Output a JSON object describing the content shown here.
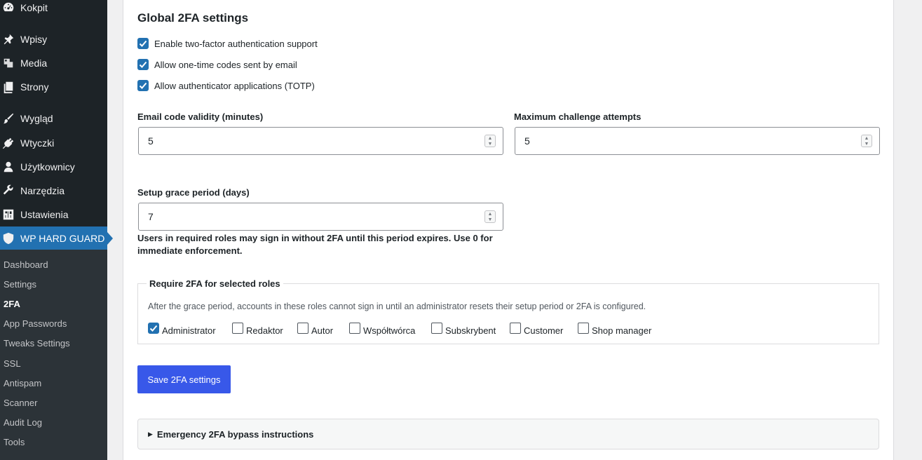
{
  "sidebar": {
    "items": [
      {
        "label": "Kokpit",
        "icon": "dashboard-icon"
      },
      {
        "label": "Wpisy",
        "icon": "pin-icon"
      },
      {
        "label": "Media",
        "icon": "media-icon"
      },
      {
        "label": "Strony",
        "icon": "pages-icon"
      },
      {
        "label": "Wygląd",
        "icon": "brush-icon"
      },
      {
        "label": "Wtyczki",
        "icon": "plugin-icon"
      },
      {
        "label": "Użytkownicy",
        "icon": "user-icon"
      },
      {
        "label": "Narzędzia",
        "icon": "wrench-icon"
      },
      {
        "label": "Ustawienia",
        "icon": "settings-icon"
      },
      {
        "label": "WP HARD GUARD",
        "icon": "shield-icon",
        "active": true
      }
    ],
    "submenu": [
      "Dashboard",
      "Settings",
      "2FA",
      "App Passwords",
      "Tweaks Settings",
      "SSL",
      "Antispam",
      "Scanner",
      "Audit Log",
      "Tools"
    ],
    "current_submenu": "2FA"
  },
  "panel": {
    "title": "Global 2FA settings",
    "options": [
      {
        "label": "Enable two-factor authentication support",
        "checked": true
      },
      {
        "label": "Allow one-time codes sent by email",
        "checked": true
      },
      {
        "label": "Allow authenticator applications (TOTP)",
        "checked": true
      }
    ],
    "email_validity": {
      "label": "Email code validity (minutes)",
      "value": "5"
    },
    "max_attempts": {
      "label": "Maximum challenge attempts",
      "value": "5"
    },
    "grace": {
      "label": "Setup grace period (days)",
      "value": "7",
      "help": "Users in required roles may sign in without 2FA until this period expires. Use 0 for immediate enforcement."
    },
    "roles": {
      "legend": "Require 2FA for selected roles",
      "description": "After the grace period, accounts in these roles cannot sign in until an administrator resets their setup period or 2FA is configured.",
      "items": [
        {
          "label": "Administrator",
          "checked": true
        },
        {
          "label": "Redaktor",
          "checked": false
        },
        {
          "label": "Autor",
          "checked": false
        },
        {
          "label": "Współtwórca",
          "checked": false
        },
        {
          "label": "Subskrybent",
          "checked": false
        },
        {
          "label": "Customer",
          "checked": false
        },
        {
          "label": "Shop manager",
          "checked": false
        }
      ]
    },
    "save_label": "Save 2FA settings",
    "emergency_label": "Emergency 2FA bypass instructions"
  },
  "colors": {
    "accent": "#2271b1",
    "primary_button": "#3858e9",
    "sidebar_bg": "#1d2327",
    "submenu_bg": "#2c3338"
  }
}
